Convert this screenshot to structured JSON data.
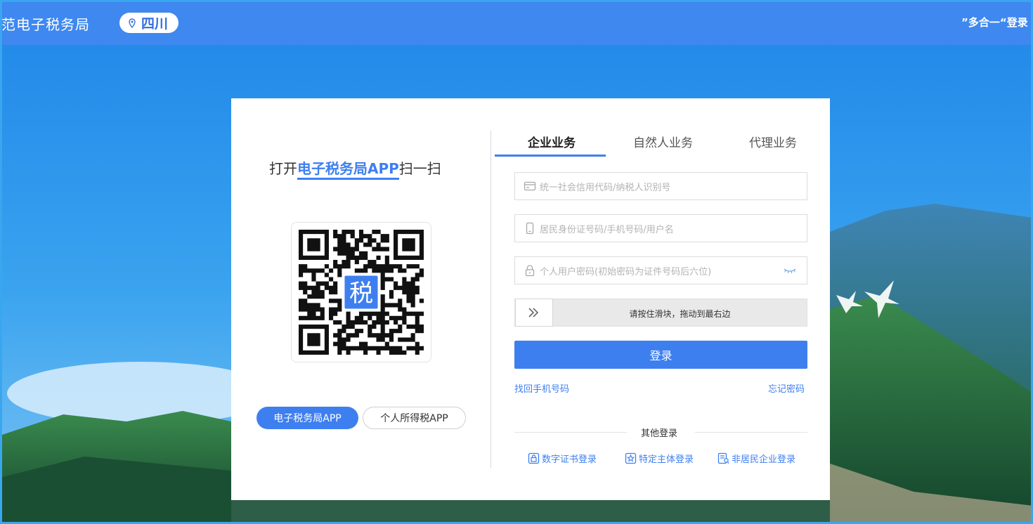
{
  "header": {
    "site_title": "范电子税务局",
    "region": "四川",
    "marquee": "”多合一“登录"
  },
  "left_panel": {
    "scan_prefix": "打开",
    "scan_app": "电子税务局APP",
    "scan_suffix": "扫一扫",
    "qr_center_glyph": "税",
    "buttons": [
      "电子税务局APP",
      "个人所得税APP"
    ]
  },
  "tabs": [
    {
      "label": "企业业务",
      "active": true
    },
    {
      "label": "自然人业务",
      "active": false
    },
    {
      "label": "代理业务",
      "active": false
    }
  ],
  "form": {
    "credit_code_placeholder": "统一社会信用代码/纳税人识别号",
    "account_placeholder": "居民身份证号码/手机号码/用户名",
    "password_placeholder": "个人用户密码(初始密码为证件号码后六位)",
    "slider_text": "请按住滑块，拖动到最右边",
    "login_label": "登录",
    "recover_phone": "找回手机号码",
    "forgot_password": "忘记密码"
  },
  "other_login": {
    "label": "其他登录",
    "options": [
      "数字证书登录",
      "特定主体登录",
      "非居民企业登录"
    ]
  },
  "colors": {
    "accent": "#3e7ff0",
    "header_bg": "#3e88f0"
  }
}
